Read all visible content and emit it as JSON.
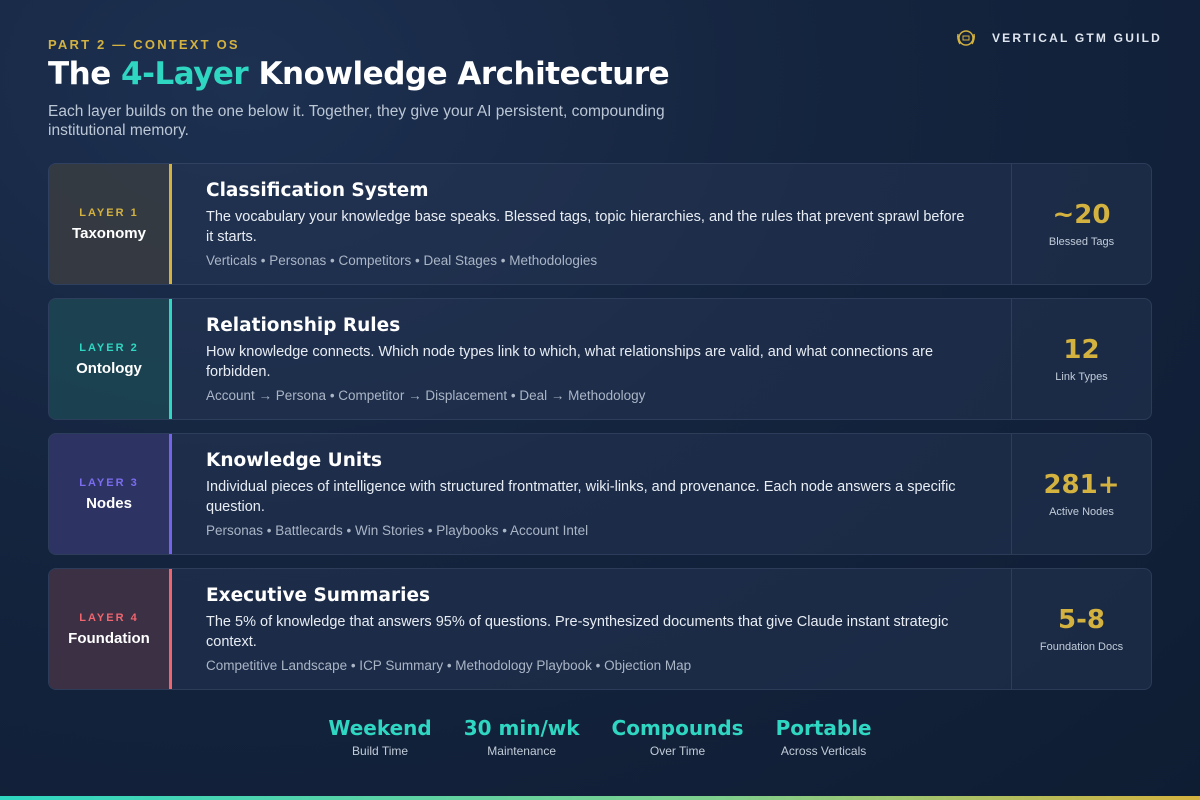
{
  "header": {
    "eyebrow": "PART 2 — CONTEXT OS",
    "title_pre": "The ",
    "title_accent": "4-Layer",
    "title_post": " Knowledge Architecture",
    "subtitle": "Each layer builds on the one below it. Together, they give your AI persistent, compounding institutional memory.",
    "brand": "VERTICAL GTM GUILD",
    "brand_icon": "laurel-emblem-icon"
  },
  "colors": {
    "gold": "#d4b23f",
    "teal": "#2fd6c1",
    "purple": "#7563ea",
    "coral": "#ec6670"
  },
  "layers": [
    {
      "num": "LAYER 1",
      "name": "Taxonomy",
      "heading": "Classification System",
      "desc": "The vocabulary your knowledge base speaks. Blessed tags, topic hierarchies, and the rules that prevent sprawl before it starts.",
      "tags": "Verticals • Personas • Competitors • Deal Stages • Methodologies",
      "metric_value": "~20",
      "metric_label": "Blessed Tags"
    },
    {
      "num": "LAYER 2",
      "name": "Ontology",
      "heading": "Relationship Rules",
      "desc": "How knowledge connects. Which node types link to which, what relationships are valid, and what connections are forbidden.",
      "tags": "Account → Persona • Competitor → Displacement • Deal → Methodology",
      "metric_value": "12",
      "metric_label": "Link Types"
    },
    {
      "num": "LAYER 3",
      "name": "Nodes",
      "heading": "Knowledge Units",
      "desc": "Individual pieces of intelligence with structured frontmatter, wiki-links, and provenance. Each node answers a specific question.",
      "tags": "Personas • Battlecards • Win Stories • Playbooks • Account Intel",
      "metric_value": "281+",
      "metric_label": "Active Nodes"
    },
    {
      "num": "LAYER 4",
      "name": "Foundation",
      "heading": "Executive Summaries",
      "desc": "The 5% of knowledge that answers 95% of questions. Pre-synthesized documents that give Claude instant strategic context.",
      "tags": "Competitive Landscape • ICP Summary • Methodology Playbook • Objection Map",
      "metric_value": "5-8",
      "metric_label": "Foundation Docs"
    }
  ],
  "stats": [
    {
      "value": "Weekend",
      "label": "Build Time"
    },
    {
      "value": "30 min/wk",
      "label": "Maintenance"
    },
    {
      "value": "Compounds",
      "label": "Over Time"
    },
    {
      "value": "Portable",
      "label": "Across Verticals"
    }
  ]
}
